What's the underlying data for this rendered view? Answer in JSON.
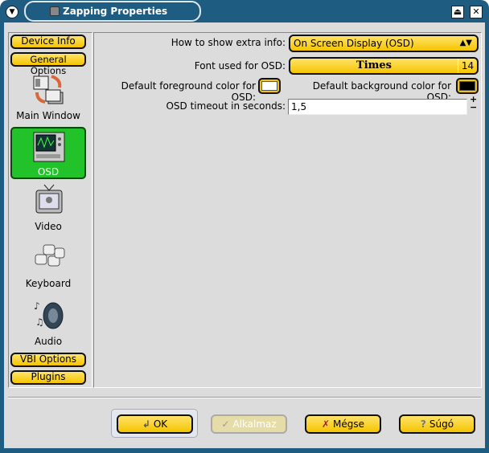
{
  "window": {
    "title": "Zapping Properties",
    "menu_icon": "chevron-down-icon",
    "shade_icon": "eject-icon",
    "close_icon": "close-icon"
  },
  "sidebar": {
    "items": [
      {
        "label": "Device Info",
        "type": "group"
      },
      {
        "label": "General Options",
        "type": "group"
      },
      {
        "label": "Main Window",
        "icon": "main-window-icon"
      },
      {
        "label": "OSD",
        "icon": "osd-icon",
        "selected": true
      },
      {
        "label": "Video",
        "icon": "tv-icon"
      },
      {
        "label": "Keyboard",
        "icon": "keyboard-icon"
      },
      {
        "label": "Audio",
        "icon": "speaker-icon"
      },
      {
        "label": "VBI Options",
        "type": "group"
      },
      {
        "label": "Plugins",
        "type": "group"
      }
    ]
  },
  "osd": {
    "extra_info_label": "How to show extra info:",
    "extra_info_value": "On Screen Display (OSD)",
    "font_label": "Font used for OSD:",
    "font_name": "Times",
    "font_size": "14",
    "fg_label": "Default foreground color for OSD:",
    "fg_color": "#ffffff",
    "bg_label": "Default background color for OSD:",
    "bg_color": "#000000",
    "timeout_label": "OSD timeout in seconds:",
    "timeout_value": "1,5"
  },
  "buttons": {
    "ok": "OK",
    "apply": "Alkalmaz",
    "cancel": "Mégse",
    "help": "Súgó"
  },
  "colors": {
    "accent": "#f5c400",
    "selected": "#22c22a",
    "frame": "#1f5c82"
  }
}
